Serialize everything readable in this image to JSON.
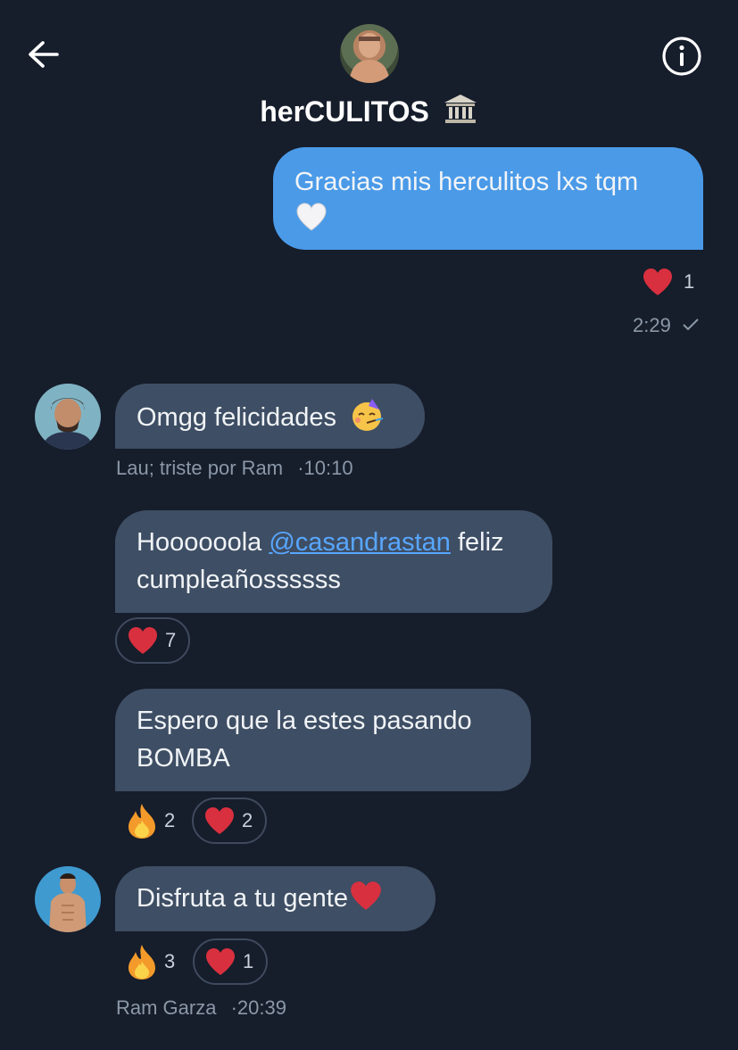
{
  "header": {
    "title": "herCULITOS",
    "back_icon": "arrow-left-icon",
    "info_icon": "info-circle-icon",
    "title_icon": "classical-building-icon"
  },
  "messages": [
    {
      "direction": "outgoing",
      "text": "Gracias mis herculitos lxs tqm",
      "emoji": "white-heart",
      "reactions": [
        {
          "icon": "heart-icon",
          "count": "1"
        }
      ],
      "time": "2:29",
      "status_icon": "check-icon"
    },
    {
      "direction": "incoming",
      "text": "Omgg felicidades",
      "emoji": "partying-face",
      "sender": "Lau; triste por Ram",
      "time": "·10:10"
    },
    {
      "direction": "incoming",
      "text_before": "Hoooooola ",
      "mention": "@casandrastan",
      "text_after": " feliz",
      "line2": "cumpleañossssss",
      "reactions": [
        {
          "icon": "heart-icon",
          "count": "7"
        }
      ]
    },
    {
      "direction": "incoming",
      "line1": "Espero que la estes pasando",
      "line2": "BOMBA",
      "reactions": [
        {
          "icon": "fire-icon",
          "count": "2"
        },
        {
          "icon": "heart-icon",
          "count": "2"
        }
      ]
    },
    {
      "direction": "incoming",
      "text": "Disfruta a tu gente",
      "emoji": "red-heart",
      "reactions": [
        {
          "icon": "fire-icon",
          "count": "3"
        },
        {
          "icon": "heart-icon",
          "count": "1"
        }
      ],
      "sender": "Ram Garza",
      "time": "·20:39"
    }
  ],
  "colors": {
    "background": "#161d2b",
    "outgoing_bubble": "#4a9ae8",
    "incoming_bubble": "#3e4e64",
    "heart": "#d9303f",
    "mention": "#58a6ff"
  }
}
